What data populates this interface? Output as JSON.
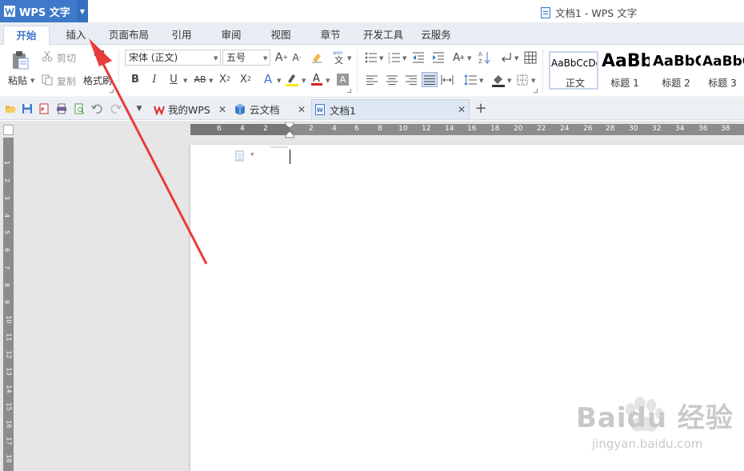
{
  "app": {
    "name": "WPS 文字",
    "window_title": "文档1 - WPS 文字"
  },
  "menu_tabs": [
    {
      "label": "开始",
      "active": true
    },
    {
      "label": "插入"
    },
    {
      "label": "页面布局"
    },
    {
      "label": "引用"
    },
    {
      "label": "审阅"
    },
    {
      "label": "视图"
    },
    {
      "label": "章节"
    },
    {
      "label": "开发工具"
    },
    {
      "label": "云服务"
    }
  ],
  "ribbon": {
    "clipboard": {
      "paste": "粘贴",
      "cut": "剪切",
      "copy": "复制",
      "format_painter": "格式刷"
    },
    "font": {
      "name": "宋体 (正文)",
      "size": "五号"
    },
    "styles": [
      {
        "preview": "AaBbCcDd",
        "name": "正文"
      },
      {
        "preview": "AaBb",
        "name": "标题 1"
      },
      {
        "preview": "AaBbC",
        "name": "标题 2"
      },
      {
        "preview": "AaBbC",
        "name": "标题 3"
      }
    ]
  },
  "doc_tabs": [
    {
      "label": "我的WPS"
    },
    {
      "label": "云文档"
    },
    {
      "label": "文档1",
      "active": true
    }
  ],
  "ruler": {
    "horizontal": [
      "6",
      "4",
      "2",
      "2",
      "4",
      "6",
      "8",
      "10",
      "12",
      "14",
      "16",
      "18",
      "20",
      "22",
      "24",
      "26",
      "28",
      "30",
      "32",
      "34",
      "36",
      "38"
    ],
    "vertical": [
      "1",
      "2",
      "3",
      "4",
      "5",
      "6",
      "7",
      "8",
      "9",
      "10",
      "11",
      "12",
      "13",
      "14",
      "15",
      "16",
      "17",
      "18"
    ]
  },
  "watermark": {
    "brand": "Baidu 经验",
    "url": "jingyan.baidu.com"
  },
  "colors": {
    "accent": "#3f79c9",
    "arrow": "#e83b3b",
    "workspace": "#e6e6e6"
  }
}
